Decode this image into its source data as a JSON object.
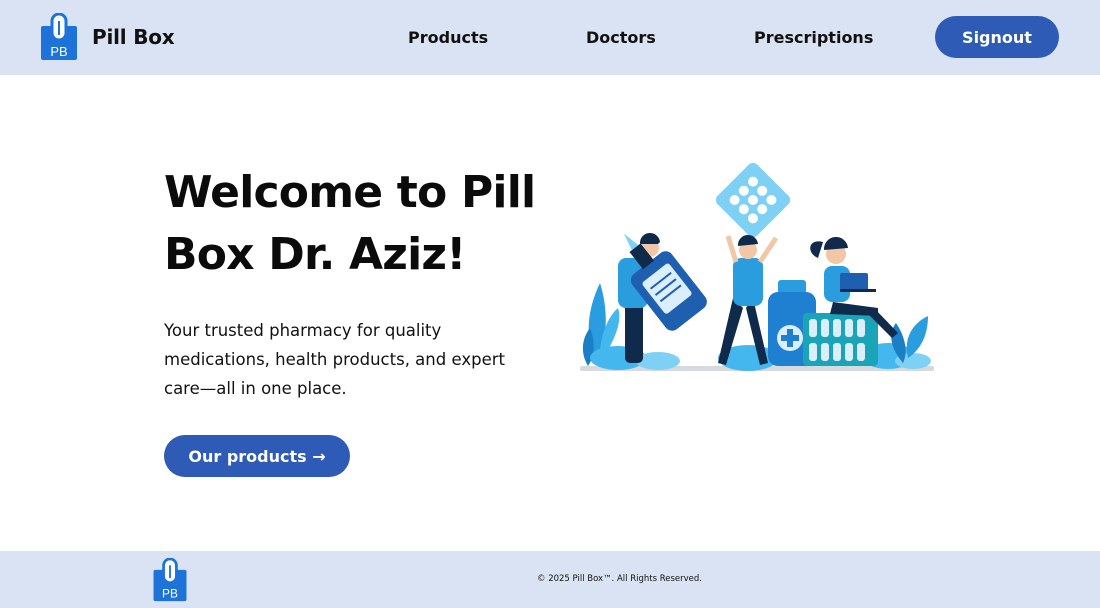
{
  "header": {
    "brand": {
      "logo_text": "PB",
      "name": "Pill Box"
    },
    "nav": [
      {
        "label": "Products"
      },
      {
        "label": "Doctors"
      },
      {
        "label": "Prescriptions"
      }
    ],
    "signout_label": "Signout"
  },
  "hero": {
    "title": "Welcome to Pill Box Dr. Aziz!",
    "description": "Your trusted pharmacy for quality medications, health products, and expert care—all in one place.",
    "cta_label": "Our products →"
  },
  "footer": {
    "logo_text": "PB",
    "copyright": "© 2025 Pill Box™. All Rights Reserved."
  },
  "colors": {
    "header_bg": "#dae3f3",
    "accent": "#2d5bb5",
    "logo_blue": "#1e73d8"
  }
}
